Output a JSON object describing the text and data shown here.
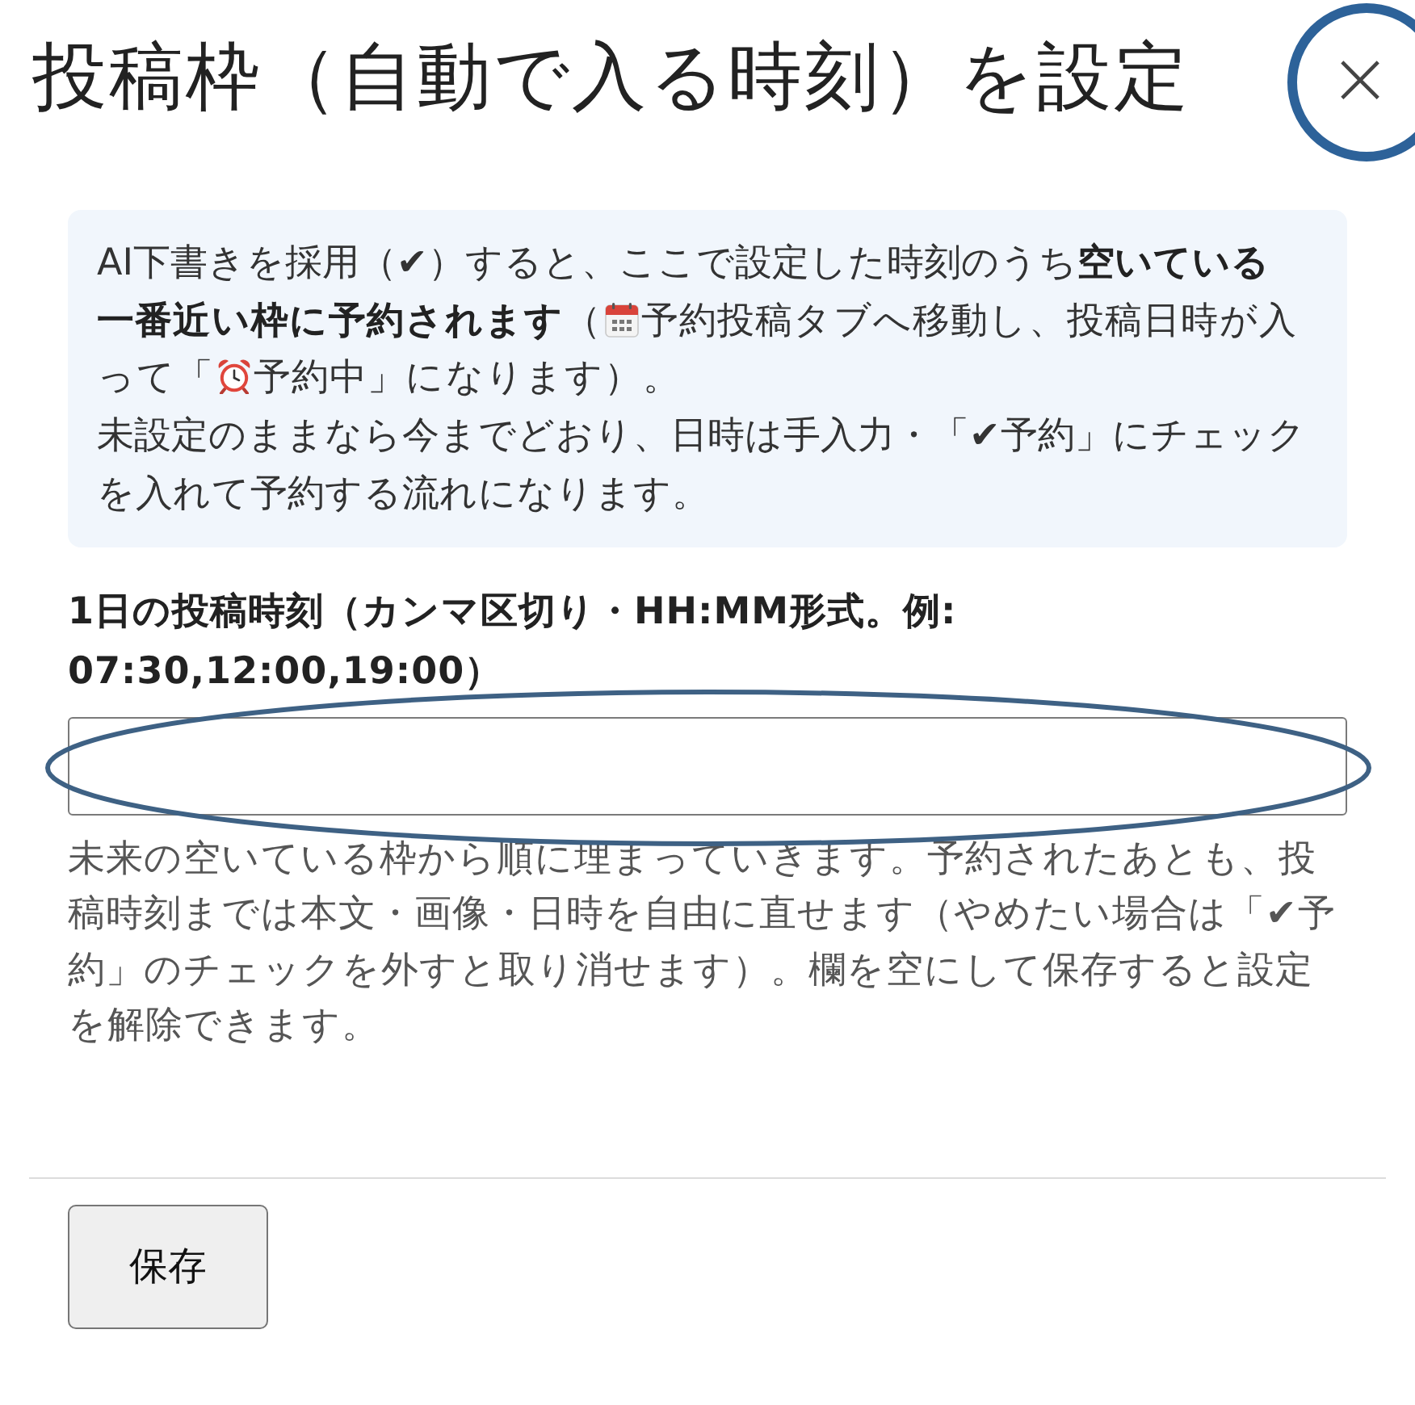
{
  "dialog": {
    "title": "投稿枠（自動で入る時刻）を設定",
    "close_button": {
      "label": "×",
      "highlighted": true
    }
  },
  "notice": {
    "paragraphs": [
      {
        "lines": [
          [
            {
              "kind": "text",
              "text": "AI下書きを採用（✔）すると、ここで設定した時刻のうち**空いている**"
            }
          ],
          [
            {
              "kind": "text",
              "text": "**一番近い枠に予約されます**（"
            },
            {
              "kind": "calendar"
            },
            {
              "kind": "text",
              "text": "予約投稿タブへ移動し、投稿日時が入"
            }
          ],
          [
            {
              "kind": "text",
              "text": "って「"
            },
            {
              "kind": "alarm_clock"
            },
            {
              "kind": "text",
              "text": "予約中」になります）。"
            }
          ]
        ]
      },
      {
        "lines": [
          [
            {
              "kind": "text",
              "text": "未設定のままなら今までどおり、日時は手入力・「✔予約」にチェックを入れて予約する流れになります。"
            }
          ]
        ]
      }
    ]
  },
  "time_field": {
    "label": "1日の投稿時刻（カンマ区切り・HH:MM形式。例: 07:30,12:00,19:00）",
    "highlighted": true
  },
  "help_text": "未来の空いている枠から順に埋まっていきます。予約されたあとも、投稿時刻までは本文・画像・日時を自由に直せます（やめたい場合は「✔予約」のチェックを外すと取り消せます）。欄を空にして保存すると設定を解除できます。",
  "buttons": [
    {
      "label": "保存"
    }
  ]
}
